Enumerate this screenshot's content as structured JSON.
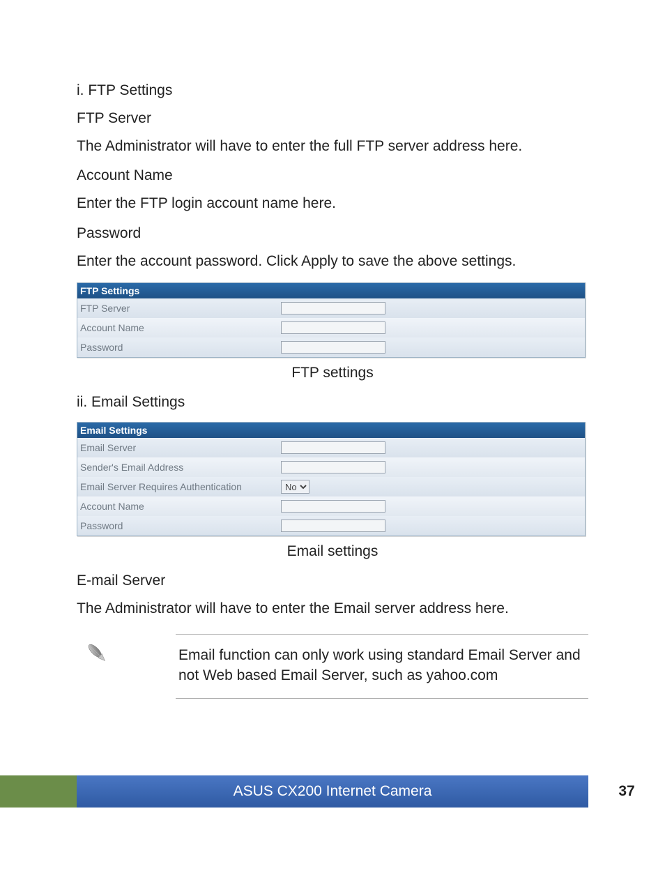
{
  "headings": {
    "ftp_settings": "i. FTP Settings",
    "ftp_server": "FTP Server",
    "account_name": "Account Name",
    "password": "Password",
    "email_settings": "ii. Email Settings",
    "email_server": "E-mail Server"
  },
  "paras": {
    "ftp_server_desc": "The Administrator will have to enter the full FTP server address here.",
    "account_name_desc": "Enter the FTP login account name here.",
    "password_desc": "Enter the account password.  Click Apply to save the above settings.",
    "email_server_desc": "The Administrator will have to enter the Email server address here.",
    "note": "Email function can only work using standard Email Server and not Web based Email Server, such as yahoo.com"
  },
  "captions": {
    "ftp": "FTP settings",
    "email": "Email settings"
  },
  "ftp_panel": {
    "header": "FTP Settings",
    "rows": {
      "server": "FTP Server",
      "account": "Account Name",
      "password": "Password"
    }
  },
  "email_panel": {
    "header": "Email Settings",
    "rows": {
      "server": "Email Server",
      "sender": "Sender's Email Address",
      "auth": "Email Server Requires Authentication",
      "auth_value": "No",
      "account": "Account Name",
      "password": "Password"
    }
  },
  "footer": {
    "title": "ASUS CX200 Internet Camera",
    "page": "37"
  }
}
